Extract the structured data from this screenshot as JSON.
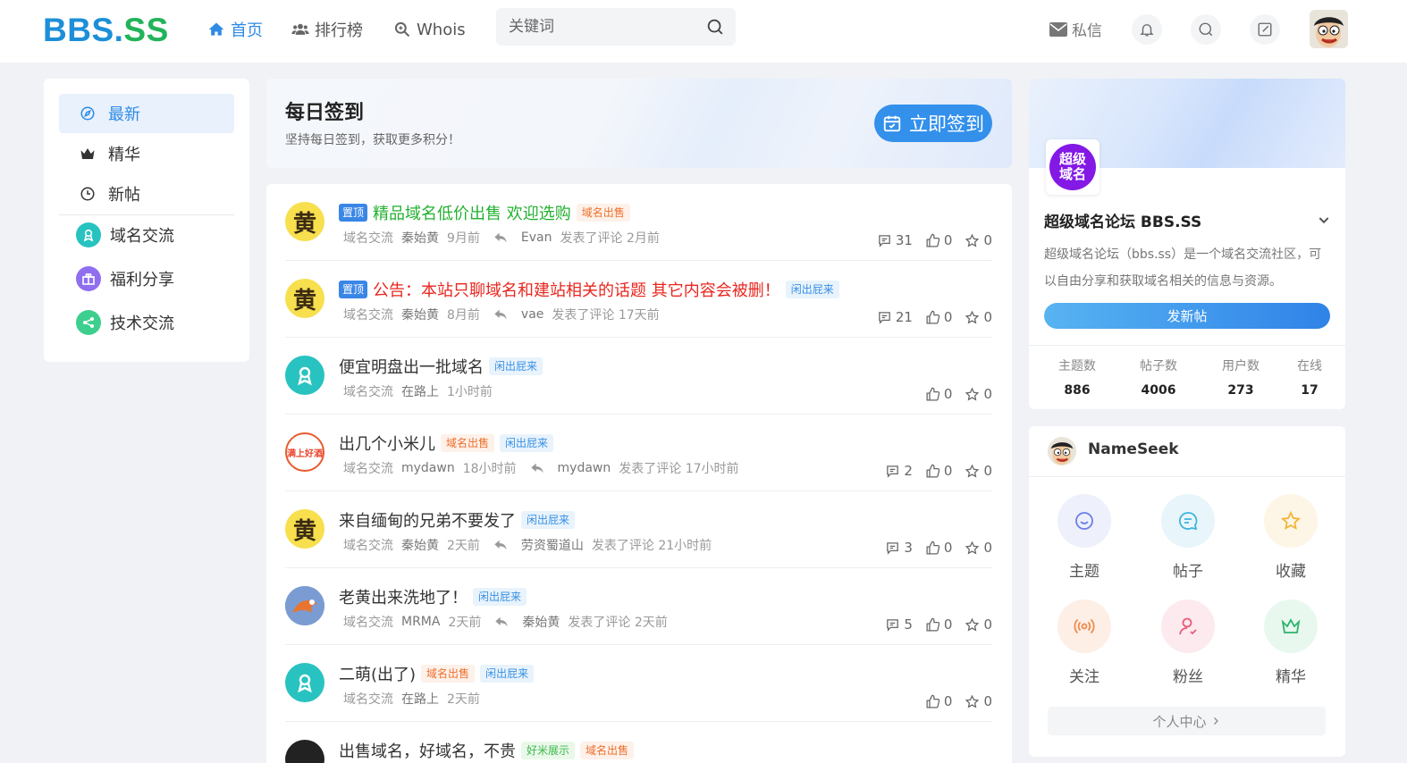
{
  "header": {
    "logo_part1": "BBS.",
    "logo_part2": "SS",
    "nav": [
      {
        "label": "首页",
        "icon": "home-icon"
      },
      {
        "label": "排行榜",
        "icon": "users-icon"
      },
      {
        "label": "Whois",
        "icon": "magnify-icon"
      }
    ],
    "search_placeholder": "关键词",
    "messages_label": "私信",
    "colors": {
      "accent": "#2f8ae5",
      "logo_blue": "#1d8fd8",
      "logo_green": "#22b35a"
    }
  },
  "left_nav": {
    "items": [
      {
        "label": "最新",
        "icon": "compass-icon",
        "active": true
      },
      {
        "label": "精华",
        "icon": "crown-icon"
      },
      {
        "label": "新帖",
        "icon": "clock-icon"
      }
    ],
    "categories": [
      {
        "label": "域名交流",
        "icon": "award-icon",
        "color": "#28c3c0"
      },
      {
        "label": "福利分享",
        "icon": "gift-icon",
        "color": "#8f6ef0"
      },
      {
        "label": "技术交流",
        "icon": "share-icon",
        "color": "#3dcf8e"
      }
    ]
  },
  "checkin": {
    "title": "每日签到",
    "subtitle": "坚持每日签到，获取更多积分！",
    "button": "立即签到"
  },
  "posts": [
    {
      "pinned": "置顶",
      "title": "精品域名低价出售 欢迎选购",
      "title_color": "green",
      "tags": [
        {
          "text": "域名出售",
          "kind": "orange"
        }
      ],
      "category": "域名交流",
      "author": "秦始黄",
      "time": "9月前",
      "reply_user": "Evan",
      "reply_text": "发表了评论 2月前",
      "comments": "31",
      "likes": "0",
      "stars": "0",
      "avatar": "huang"
    },
    {
      "pinned": "置顶",
      "title": "公告：本站只聊域名和建站相关的话题 其它内容会被删！",
      "title_color": "red",
      "tags": [
        {
          "text": "闲出屁来",
          "kind": "blue"
        }
      ],
      "category": "域名交流",
      "author": "秦始黄",
      "time": "8月前",
      "reply_user": "vae",
      "reply_text": "发表了评论 17天前",
      "comments": "21",
      "likes": "0",
      "stars": "0",
      "avatar": "huang"
    },
    {
      "title": "便宜明盘出一批域名",
      "tags": [
        {
          "text": "闲出屁来",
          "kind": "blue"
        }
      ],
      "category": "域名交流",
      "author": "在路上",
      "time": "1小时前",
      "likes": "0",
      "stars": "0",
      "avatar": "teal"
    },
    {
      "title": "出几个小米儿",
      "tags": [
        {
          "text": "域名出售",
          "kind": "orange"
        },
        {
          "text": "闲出屁来",
          "kind": "blue"
        }
      ],
      "category": "域名交流",
      "author": "mydawn",
      "time": "18小时前",
      "reply_user": "mydawn",
      "reply_text": "发表了评论 17小时前",
      "comments": "2",
      "likes": "0",
      "stars": "0",
      "avatar": "red",
      "avatar_text": "满上好酒"
    },
    {
      "title": "来自缅甸的兄弟不要发了",
      "tags": [
        {
          "text": "闲出屁来",
          "kind": "blue"
        }
      ],
      "category": "域名交流",
      "author": "秦始黄",
      "time": "2天前",
      "reply_user": "劳资蜀道山",
      "reply_text": "发表了评论 21小时前",
      "comments": "3",
      "likes": "0",
      "stars": "0",
      "avatar": "huang"
    },
    {
      "title": "老黄出来洗地了！",
      "tags": [
        {
          "text": "闲出屁来",
          "kind": "blue"
        }
      ],
      "category": "域名交流",
      "author": "MRMA",
      "time": "2天前",
      "reply_user": "秦始黄",
      "reply_text": "发表了评论 2天前",
      "comments": "5",
      "likes": "0",
      "stars": "0",
      "avatar": "img"
    },
    {
      "title": "二萌(出了)",
      "tags": [
        {
          "text": "域名出售",
          "kind": "orange"
        },
        {
          "text": "闲出屁来",
          "kind": "blue"
        }
      ],
      "category": "域名交流",
      "author": "在路上",
      "time": "2天前",
      "likes": "0",
      "stars": "0",
      "avatar": "teal"
    },
    {
      "title": "出售域名，好域名，不贵",
      "tags": [
        {
          "text": "好米展示",
          "kind": "green"
        },
        {
          "text": "域名出售",
          "kind": "orange"
        }
      ],
      "category": "域名交流",
      "author": "",
      "time": "",
      "likes": "0",
      "stars": "0",
      "avatar": "dark"
    }
  ],
  "huang_char": "黄",
  "forum": {
    "logo_text": "超级域名",
    "name": "超级域名论坛 BBS.SS",
    "description": "超级域名论坛（bbs.ss）是一个域名交流社区，可以自由分享和获取域名相关的信息与资源。",
    "post_button": "发新帖",
    "stats": [
      {
        "label": "主题数",
        "value": "886"
      },
      {
        "label": "帖子数",
        "value": "4006"
      },
      {
        "label": "用户数",
        "value": "273"
      },
      {
        "label": "在线",
        "value": "17"
      }
    ]
  },
  "user": {
    "name": "NameSeek",
    "items": [
      {
        "label": "主题",
        "icon": "chat-bubble-icon",
        "bg": "#eef0fb",
        "fg": "#6b7de8"
      },
      {
        "label": "帖子",
        "icon": "comment-icon",
        "bg": "#e8f6fb",
        "fg": "#3cb3dc"
      },
      {
        "label": "收藏",
        "icon": "star-icon",
        "bg": "#fdf6e6",
        "fg": "#f2b43a"
      },
      {
        "label": "关注",
        "icon": "broadcast-icon",
        "bg": "#fdeee6",
        "fg": "#f08a4a"
      },
      {
        "label": "粉丝",
        "icon": "user-icon",
        "bg": "#fdeaee",
        "fg": "#ec5a7a"
      },
      {
        "label": "精华",
        "icon": "crown-icon",
        "bg": "#e8f8ef",
        "fg": "#2fb36c"
      }
    ],
    "center_label": "个人中心"
  }
}
